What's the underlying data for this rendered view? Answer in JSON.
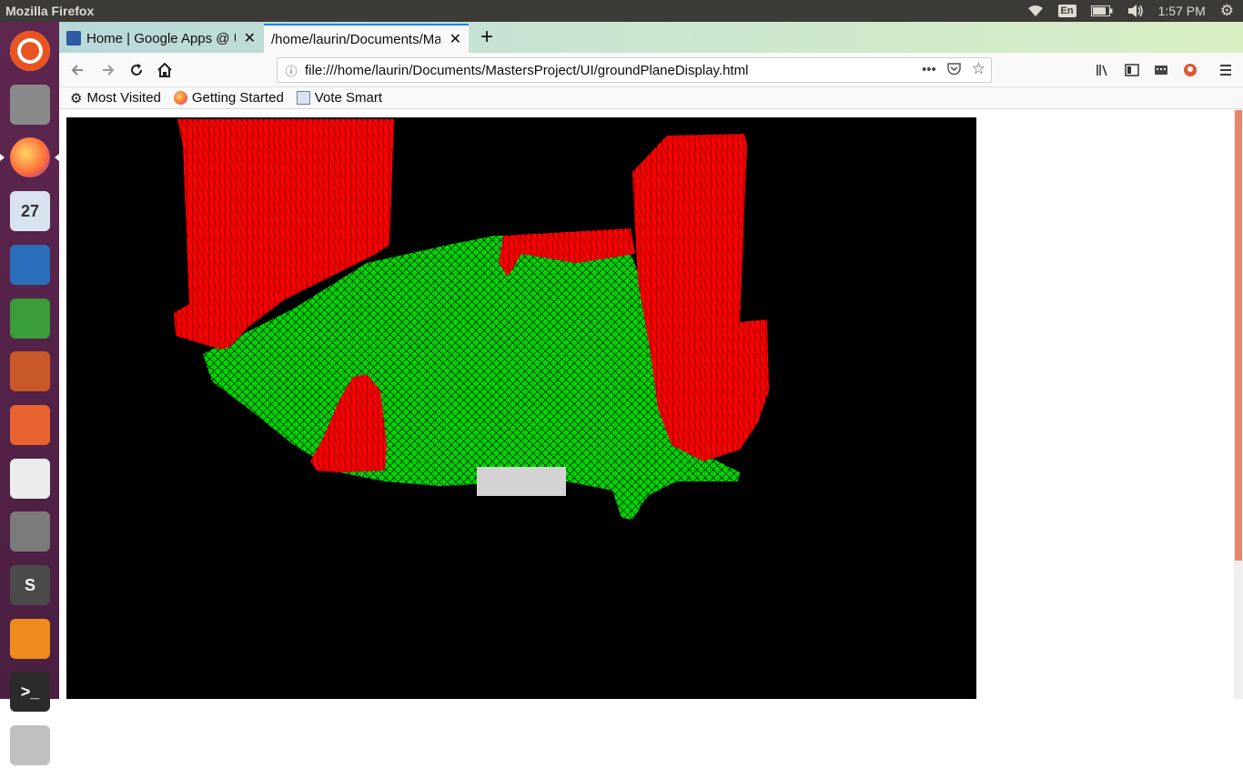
{
  "panel": {
    "window_title": "Mozilla Firefox",
    "keyboard_layout": "En",
    "clock": "1:57 PM"
  },
  "launcher": {
    "items": [
      {
        "name": "ubuntu-dash-icon",
        "color": "#e95420"
      },
      {
        "name": "files-icon",
        "color": "#8a8a8a"
      },
      {
        "name": "firefox-icon",
        "color": "#ff7139"
      },
      {
        "name": "calendar-icon",
        "color": "#d9e3ef",
        "label": "27"
      },
      {
        "name": "writer-icon",
        "color": "#2a6ebb"
      },
      {
        "name": "calc-icon",
        "color": "#3b9c3a"
      },
      {
        "name": "impress-icon",
        "color": "#c9582a"
      },
      {
        "name": "software-center-icon",
        "color": "#e8632f"
      },
      {
        "name": "amazon-icon",
        "color": "#ececec"
      },
      {
        "name": "settings-icon",
        "color": "#7b7b7b"
      },
      {
        "name": "sublime-icon",
        "color": "#4a4a4a",
        "label": "S"
      },
      {
        "name": "blender-icon",
        "color": "#f08c1d"
      },
      {
        "name": "terminal-icon",
        "color": "#2b2b2b",
        "label": ">_"
      },
      {
        "name": "scanner-icon",
        "color": "#c0c0c0"
      }
    ]
  },
  "tabs": [
    {
      "title": "Home | Google Apps @ U",
      "close": "✕"
    },
    {
      "title": "/home/laurin/Documents/Ma",
      "close": "✕"
    }
  ],
  "newtab_label": "+",
  "url": "file:///home/laurin/Documents/MastersProject/UI/groundPlaneDisplay.html",
  "url_actions": {
    "more": "•••"
  },
  "bookmarks": [
    {
      "label": "Most Visited"
    },
    {
      "label": "Getting Started"
    },
    {
      "label": "Vote Smart"
    }
  ],
  "colors": {
    "ground": "#00ff00",
    "obstacle": "#ff0000",
    "robot": "#d3d3d3"
  }
}
